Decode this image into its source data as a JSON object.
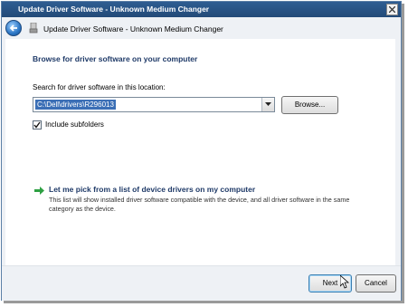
{
  "window": {
    "title": "Update Driver Software - Unknown Medium Changer"
  },
  "nav": {
    "title": "Update Driver Software - Unknown Medium Changer"
  },
  "main": {
    "heading": "Browse for driver software on your computer",
    "search_label": "Search for driver software in this location:",
    "path_value": "C:\\Dell\\drivers\\R296013",
    "browse_label": "Browse...",
    "include_subfolders_label": "Include subfolders",
    "include_subfolders_checked": true,
    "pick_title": "Let me pick from a list of device drivers on my computer",
    "pick_description": "This list will show installed driver software compatible with the device, and all driver software in the same category as the device."
  },
  "footer": {
    "next_label": "Next",
    "cancel_label": "Cancel"
  },
  "icons": {
    "close": "close-icon",
    "back": "back-arrow-icon",
    "device": "device-icon",
    "pick": "green-arrow-icon",
    "cursor": "mouse-cursor-icon"
  },
  "colors": {
    "titlebar": "#2e5d92",
    "heading_text": "#1f3a68",
    "selection": "#3b6fb6",
    "link_arrow": "#2ea043"
  }
}
